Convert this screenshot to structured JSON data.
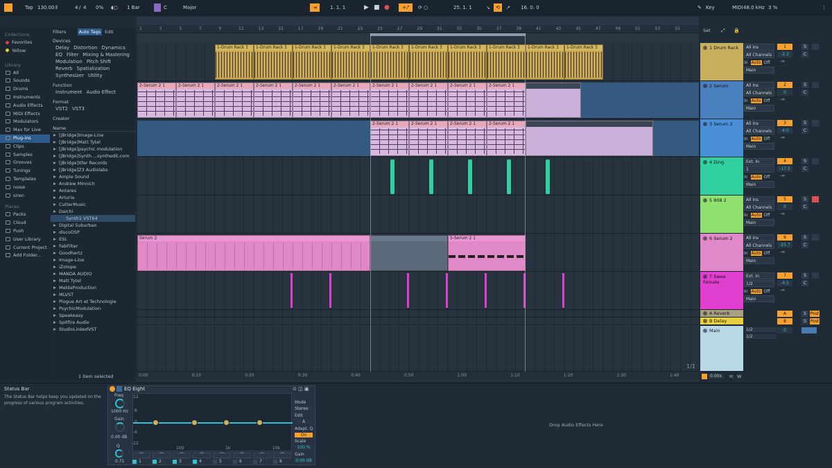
{
  "topbar": {
    "tap": "Tap",
    "tempo": "130.00",
    "sig_num": "4",
    "sig_den": "4",
    "swing": "0%",
    "quant": "1 Bar",
    "key": "C",
    "scale": "Major",
    "pos": "1.  1.  1",
    "loop_start": "25.  1.  1",
    "loop_len": "16.  0.  0",
    "key_label": "Key",
    "midi_label": "MIDI",
    "sample_rate": "48.0 kHz",
    "cpu": "3 %"
  },
  "sidebar": {
    "collections_h": "Collections",
    "favorites": "Favorites",
    "yellow": "Yellow",
    "library_h": "Library",
    "items": [
      "All",
      "Sounds",
      "Drums",
      "Instruments",
      "Audio Effects",
      "MIDI Effects",
      "Modulators",
      "Max for Live",
      "Plug-ins",
      "Clips",
      "Samples",
      "Grooves",
      "Tunings",
      "Templates",
      "noise",
      "siren"
    ],
    "places_h": "Places",
    "places": [
      "Packs",
      "Cloud",
      "Push",
      "User Library",
      "Current Project",
      "Add Folder..."
    ]
  },
  "browser": {
    "filters": "Filters",
    "auto_tags": "Auto Tags",
    "edit": "Edit",
    "devices_h": "Devices",
    "dev_tags": [
      "Delay",
      "Distortion",
      "Dynamics",
      "EQ",
      "Filter",
      "Mixing & Mastering",
      "Modulation",
      "Pitch Shift",
      "Reverb",
      "Spatialization",
      "Synthesizer",
      "Utility"
    ],
    "function_h": "Function",
    "fn_tags": [
      "Instrument",
      "Audio Effect"
    ],
    "format_h": "Format",
    "fmt_tags": [
      "VST2",
      "VST3"
    ],
    "creator_h": "Creator",
    "name_h": "Name",
    "items": [
      "[jBridge]Image-Line",
      "[jBridge]Matt Tytel",
      "[jBridge]psychic modulation",
      "[jBridge]Synth....synthedit.com",
      "[jBridge]Xfer Records",
      "[jBridge]Z3 Audiolabs",
      "Ample Sound",
      "Andrew Minnich",
      "Antares",
      "Arturia",
      "CutterMusic",
      "Daichi",
      "Synth1 VST64",
      "Digital Suburban",
      "discoDSP",
      "ESL",
      "FabFilter",
      "Goodhertz",
      "Image-Line",
      "iZotope",
      "MANDA AUDIO",
      "Matt Tytel",
      "MeldaProduction",
      "MLVST",
      "Plogue Art et Technologie",
      "PsychicModulation",
      "Speakeasy",
      "Spitfire Audio",
      "StudioLinkedVST"
    ],
    "status": "1 item selected"
  },
  "ruler": [
    "1",
    "3",
    "5",
    "7",
    "9",
    "11",
    "13",
    "15",
    "17",
    "19",
    "21",
    "23",
    "25",
    "27",
    "29",
    "31",
    "33",
    "35",
    "37",
    "39",
    "41",
    "43",
    "45",
    "47",
    "49",
    "51",
    "53",
    "55"
  ],
  "timeline": [
    "0:00",
    "0:10",
    "0:20",
    "0:30",
    "0:40",
    "0:50",
    "1:00",
    "1:10",
    "1:20",
    "1:30",
    "1:40"
  ],
  "page_indicator": "1/1",
  "tracks": [
    {
      "name": "1 Drum Rack",
      "color": "#c8b060",
      "num": "1",
      "in": "All Ins",
      "ch": "All Channels",
      "vol": "-2.3",
      "send": "-∞"
    },
    {
      "name": "2 Serum",
      "color": "#4a80c0",
      "num": "2",
      "in": "All Ins",
      "ch": "All Channels",
      "vol": "0",
      "send": "-∞"
    },
    {
      "name": "3 Serum 2",
      "color": "#4a90d8",
      "num": "3",
      "in": "All Ins",
      "ch": "All Channels",
      "vol": "-4.0",
      "send": "-∞"
    },
    {
      "name": "4 Ding",
      "color": "#30d0a0",
      "num": "4",
      "in": "Ext. In",
      "ch": "1",
      "vol": "-17.5",
      "send": "-∞"
    },
    {
      "name": "5 808 2",
      "color": "#90e070",
      "num": "5",
      "in": "All Ins",
      "ch": "All Channels",
      "vol": "0",
      "send": "-∞"
    },
    {
      "name": "6 Serum 2",
      "color": "#e088c8",
      "num": "6",
      "in": "All Ins",
      "ch": "All Channels",
      "vol": "-25.7",
      "send": "-∞"
    },
    {
      "name": "7 Swee Female",
      "color": "#e040d0",
      "num": "7",
      "in": "Ext. In",
      "ch": "1/2",
      "vol": "-4.5",
      "send": "-∞"
    }
  ],
  "returns": [
    {
      "name": "A Reverb",
      "num": "A"
    },
    {
      "name": "B Delay",
      "num": "8"
    }
  ],
  "master": {
    "name": "Main",
    "out1": "1/2",
    "out2": "1/2",
    "vol": "0"
  },
  "labels": {
    "in": "In",
    "auto": "Auto",
    "off": "Off",
    "main": "Main",
    "s": "S",
    "c": "C",
    "post": "Post",
    "set": "Set",
    "h": "H",
    "w": "W",
    "zoom": "0.00x"
  },
  "clips": {
    "drum": "1-Drum Rack 3",
    "serum": "2-Serum 2 1",
    "serum6": "Serum 2",
    "serum6b": "5-Serum 2 1"
  },
  "statusbar": {
    "title": "Status Bar",
    "text": "The Status Bar helps keep you updated on the progress of various program activities."
  },
  "eq": {
    "title": "EQ Eight",
    "freq_l": "Freq",
    "freq": "1000 Hz",
    "gain_l": "Gain",
    "gain": "0.00 dB",
    "q_l": "Q",
    "q": "0.71",
    "mode_l": "Mode",
    "mode": "Stereo",
    "edit_l": "Edit",
    "edit": "A",
    "adapt": "Adapt. Q",
    "adapt_v": "On",
    "scale_l": "Scale",
    "scale": "100 %",
    "gain2_l": "Gain",
    "gain2": "0.00 dB",
    "db": [
      "12",
      "6",
      "0",
      "-6",
      "-12"
    ],
    "hz": [
      "100",
      "1k",
      "10k"
    ],
    "bands": [
      "1",
      "2",
      "3",
      "4",
      "5",
      "6",
      "7",
      "8"
    ]
  },
  "drop": "Drop Audio Effects Here"
}
